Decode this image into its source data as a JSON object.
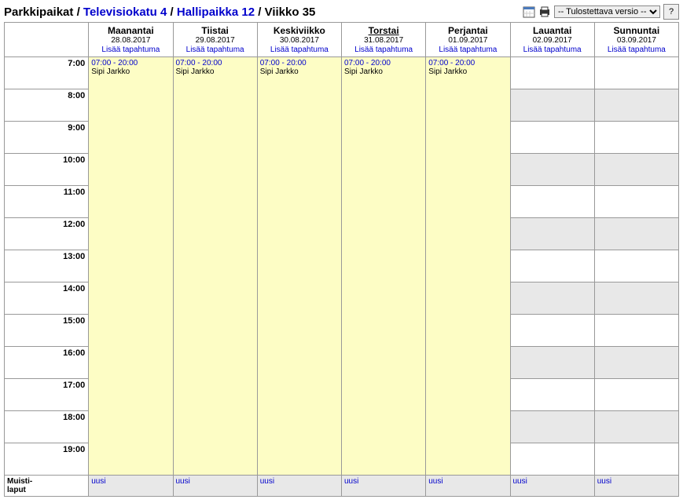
{
  "breadcrumb": {
    "root": "Parkkipaikat",
    "sep": " / ",
    "link1": "Televisiokatu 4",
    "link2": "Hallipaikka 12",
    "current": "Viikko 35"
  },
  "controls": {
    "printSelect": "-- Tulostettava versio --",
    "help": "?"
  },
  "days": [
    {
      "name": "Maanantai",
      "date": "28.08.2017",
      "add": "Lisää tapahtuma",
      "weekend": false,
      "underline": false
    },
    {
      "name": "Tiistai",
      "date": "29.08.2017",
      "add": "Lisää tapahtuma",
      "weekend": false,
      "underline": false
    },
    {
      "name": "Keskiviikko",
      "date": "30.08.2017",
      "add": "Lisää tapahtuma",
      "weekend": false,
      "underline": false
    },
    {
      "name": "Torstai",
      "date": "31.08.2017",
      "add": "Lisää tapahtuma",
      "weekend": false,
      "underline": true
    },
    {
      "name": "Perjantai",
      "date": "01.09.2017",
      "add": "Lisää tapahtuma",
      "weekend": false,
      "underline": false
    },
    {
      "name": "Lauantai",
      "date": "02.09.2017",
      "add": "Lisää tapahtuma",
      "weekend": true,
      "underline": false
    },
    {
      "name": "Sunnuntai",
      "date": "03.09.2017",
      "add": "Lisää tapahtuma",
      "weekend": true,
      "underline": false
    }
  ],
  "hours": [
    "7:00",
    "8:00",
    "9:00",
    "10:00",
    "11:00",
    "12:00",
    "13:00",
    "14:00",
    "15:00",
    "16:00",
    "17:00",
    "18:00",
    "19:00"
  ],
  "event": {
    "time": "07:00 - 20:00",
    "text": "Sipi Jarkko"
  },
  "memo": {
    "label1": "Muisti-",
    "label2": "laput",
    "new": "uusi"
  }
}
